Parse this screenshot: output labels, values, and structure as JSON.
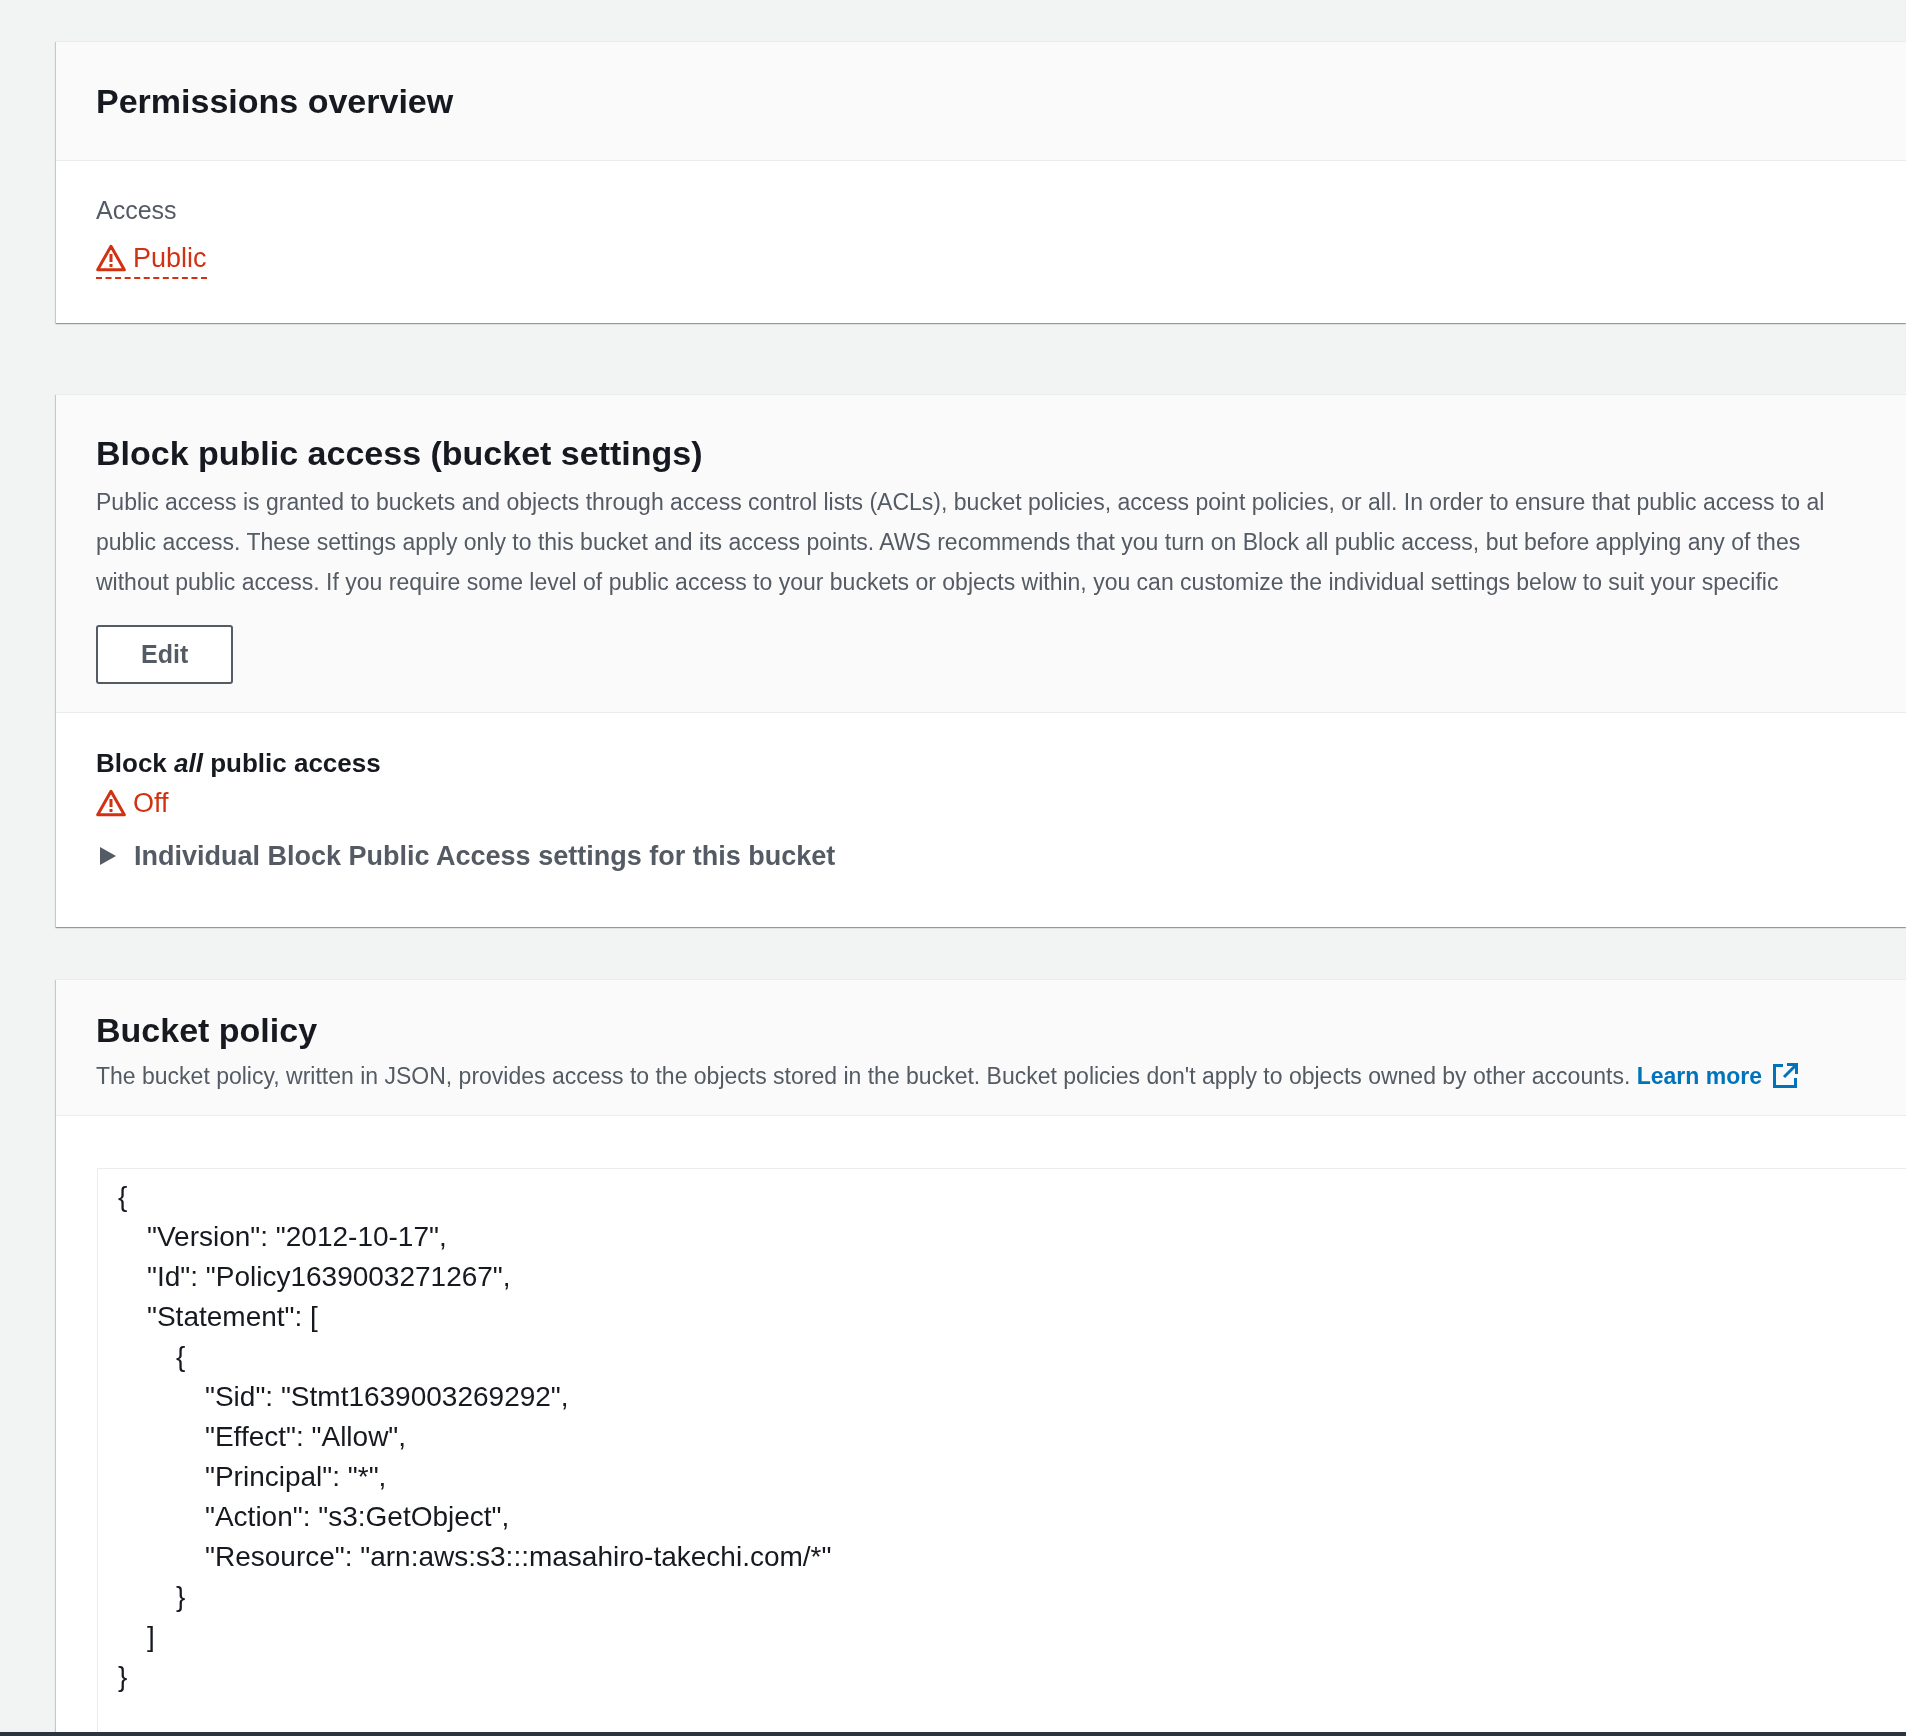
{
  "permissions_overview": {
    "title": "Permissions overview",
    "access": {
      "label": "Access",
      "value": "Public",
      "warning": true
    }
  },
  "block_public_access": {
    "title": "Block public access (bucket settings)",
    "description_lines": [
      "Public access is granted to buckets and objects through access control lists (ACLs), bucket policies, access point policies, or all. In order to ensure that public access to al",
      "public access. These settings apply only to this bucket and its access points. AWS recommends that you turn on Block all public access, but before applying any of thes",
      "without public access. If you require some level of public access to your buckets or objects within, you can customize the individual settings below to suit your specific"
    ],
    "edit_button": "Edit",
    "setting": {
      "label": "Block *all* public access",
      "value": "Off",
      "warning": true
    },
    "details": {
      "label": "Individual Block Public Access settings for this bucket",
      "expanded": false
    }
  },
  "bucket_policy": {
    "title": "Bucket policy",
    "description": "The bucket policy, written in JSON, provides access to the objects stored in the bucket. Bucket policies don't apply to objects owned by other accounts.",
    "link": "Learn more",
    "code": [
      {
        "text": "{",
        "children": [
          {
            "text": "\"Version\": \"2012-10-17\","
          },
          {
            "text": "\"Id\": \"Policy1639003271267\","
          },
          {
            "text": "\"Statement\": [",
            "children": [
              {
                "text": "{",
                "children": [
                  {
                    "text": "\"Sid\": \"Stmt1639003269292\","
                  },
                  {
                    "text": "\"Effect\": \"Allow\","
                  },
                  {
                    "text": "\"Principal\": \"*\","
                  },
                  {
                    "text": "\"Action\": \"s3:GetObject\","
                  },
                  {
                    "text": "\"Resource\": \"arn:aws:s3:::masahiro-takechi.com/*\""
                  }
                ]
              },
              {
                "text": "}"
              }
            ]
          },
          {
            "text": "]"
          }
        ]
      },
      {
        "text": "}"
      }
    ]
  }
}
